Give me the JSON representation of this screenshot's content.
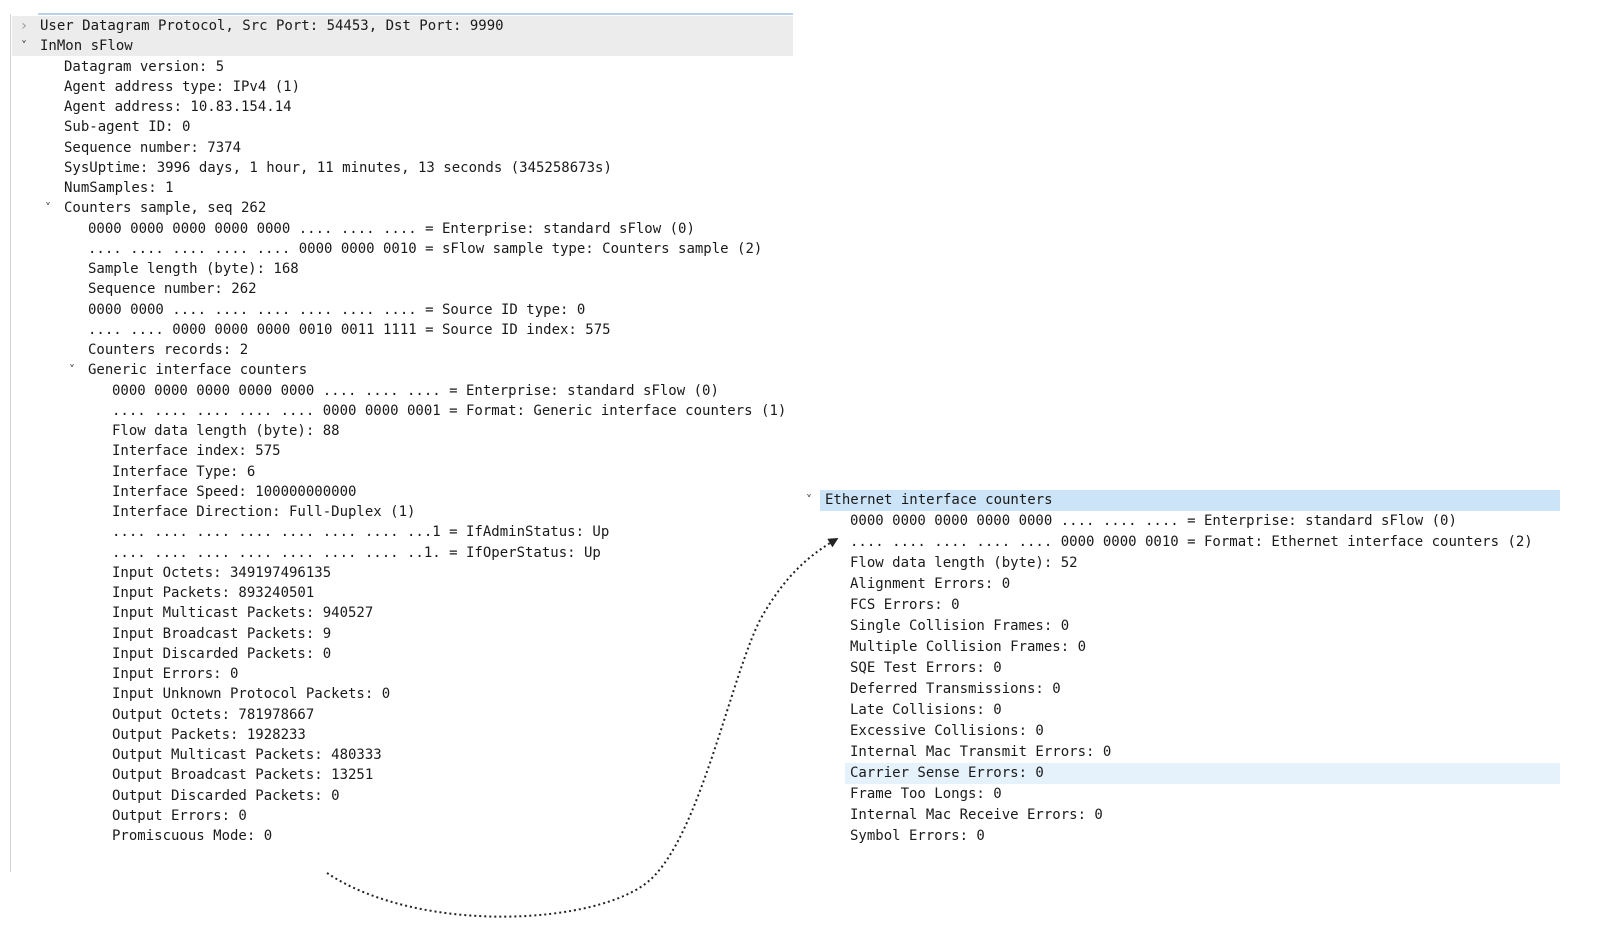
{
  "left_tree": [
    {
      "label": "User Datagram Protocol, Src Port: 54453, Dst Port: 9990",
      "level": 0,
      "toggle": "collapsed"
    },
    {
      "label": "InMon sFlow",
      "level": 0,
      "toggle": "expanded"
    },
    {
      "label": "Datagram version: 5",
      "level": 1
    },
    {
      "label": "Agent address type: IPv4 (1)",
      "level": 1
    },
    {
      "label": "Agent address: 10.83.154.14",
      "level": 1
    },
    {
      "label": "Sub-agent ID: 0",
      "level": 1
    },
    {
      "label": "Sequence number: 7374",
      "level": 1
    },
    {
      "label": "SysUptime: 3996 days, 1 hour, 11 minutes, 13 seconds (345258673s)",
      "level": 1
    },
    {
      "label": "NumSamples: 1",
      "level": 1
    },
    {
      "label": "Counters sample, seq 262",
      "level": 1,
      "toggle": "expanded"
    },
    {
      "label": "0000 0000 0000 0000 0000 .... .... .... = Enterprise: standard sFlow (0)",
      "level": 2
    },
    {
      "label": ".... .... .... .... .... 0000 0000 0010 = sFlow sample type: Counters sample (2)",
      "level": 2
    },
    {
      "label": "Sample length (byte): 168",
      "level": 2
    },
    {
      "label": "Sequence number: 262",
      "level": 2
    },
    {
      "label": "0000 0000 .... .... .... .... .... .... = Source ID type: 0",
      "level": 2
    },
    {
      "label": ".... .... 0000 0000 0000 0010 0011 1111 = Source ID index: 575",
      "level": 2
    },
    {
      "label": "Counters records: 2",
      "level": 2
    },
    {
      "label": "Generic interface counters",
      "level": 2,
      "toggle": "expanded"
    },
    {
      "label": "0000 0000 0000 0000 0000 .... .... .... = Enterprise: standard sFlow (0)",
      "level": 3
    },
    {
      "label": ".... .... .... .... .... 0000 0000 0001 = Format: Generic interface counters (1)",
      "level": 3
    },
    {
      "label": "Flow data length (byte): 88",
      "level": 3
    },
    {
      "label": "Interface index: 575",
      "level": 3
    },
    {
      "label": "Interface Type: 6",
      "level": 3
    },
    {
      "label": "Interface Speed: 100000000000",
      "level": 3
    },
    {
      "label": "Interface Direction: Full-Duplex (1)",
      "level": 3
    },
    {
      "label": ".... .... .... .... .... .... .... ...1 = IfAdminStatus: Up",
      "level": 3
    },
    {
      "label": ".... .... .... .... .... .... .... ..1. = IfOperStatus: Up",
      "level": 3
    },
    {
      "label": "Input Octets: 349197496135",
      "level": 3
    },
    {
      "label": "Input Packets: 893240501",
      "level": 3
    },
    {
      "label": "Input Multicast Packets: 940527",
      "level": 3
    },
    {
      "label": "Input Broadcast Packets: 9",
      "level": 3
    },
    {
      "label": "Input Discarded Packets: 0",
      "level": 3
    },
    {
      "label": "Input Errors: 0",
      "level": 3
    },
    {
      "label": "Input Unknown Protocol Packets: 0",
      "level": 3
    },
    {
      "label": "Output Octets: 781978667",
      "level": 3
    },
    {
      "label": "Output Packets: 1928233",
      "level": 3
    },
    {
      "label": "Output Multicast Packets: 480333",
      "level": 3
    },
    {
      "label": "Output Broadcast Packets: 13251",
      "level": 3
    },
    {
      "label": "Output Discarded Packets: 0",
      "level": 3
    },
    {
      "label": "Output Errors: 0",
      "level": 3
    },
    {
      "label": "Promiscuous Mode: 0",
      "level": 3
    }
  ],
  "right_tree": [
    {
      "label": "Ethernet interface counters",
      "level": 0,
      "toggle": "expanded",
      "state": "selected"
    },
    {
      "label": "0000 0000 0000 0000 0000 .... .... .... = Enterprise: standard sFlow (0)",
      "level": 1
    },
    {
      "label": ".... .... .... .... .... 0000 0000 0010 = Format: Ethernet interface counters (2)",
      "level": 1
    },
    {
      "label": "Flow data length (byte): 52",
      "level": 1
    },
    {
      "label": "Alignment Errors: 0",
      "level": 1
    },
    {
      "label": "FCS Errors: 0",
      "level": 1
    },
    {
      "label": "Single Collision Frames: 0",
      "level": 1
    },
    {
      "label": "Multiple Collision Frames: 0",
      "level": 1
    },
    {
      "label": "SQE Test Errors: 0",
      "level": 1
    },
    {
      "label": "Deferred Transmissions: 0",
      "level": 1
    },
    {
      "label": "Late Collisions: 0",
      "level": 1
    },
    {
      "label": "Excessive Collisions: 0",
      "level": 1
    },
    {
      "label": "Internal Mac Transmit Errors: 0",
      "level": 1
    },
    {
      "label": "Carrier Sense Errors: 0",
      "level": 1,
      "state": "hover"
    },
    {
      "label": "Frame Too Longs: 0",
      "level": 1
    },
    {
      "label": "Internal Mac Receive Errors: 0",
      "level": 1
    },
    {
      "label": "Symbol Errors: 0",
      "level": 1
    }
  ],
  "icons": {
    "expanded": "chevron-down-icon",
    "collapsed": "chevron-right-icon"
  },
  "colors": {
    "selected_row": "#cce4f7",
    "hover_row": "#e5f1fb",
    "shaded_row": "#ececec",
    "connector": "#222222"
  }
}
